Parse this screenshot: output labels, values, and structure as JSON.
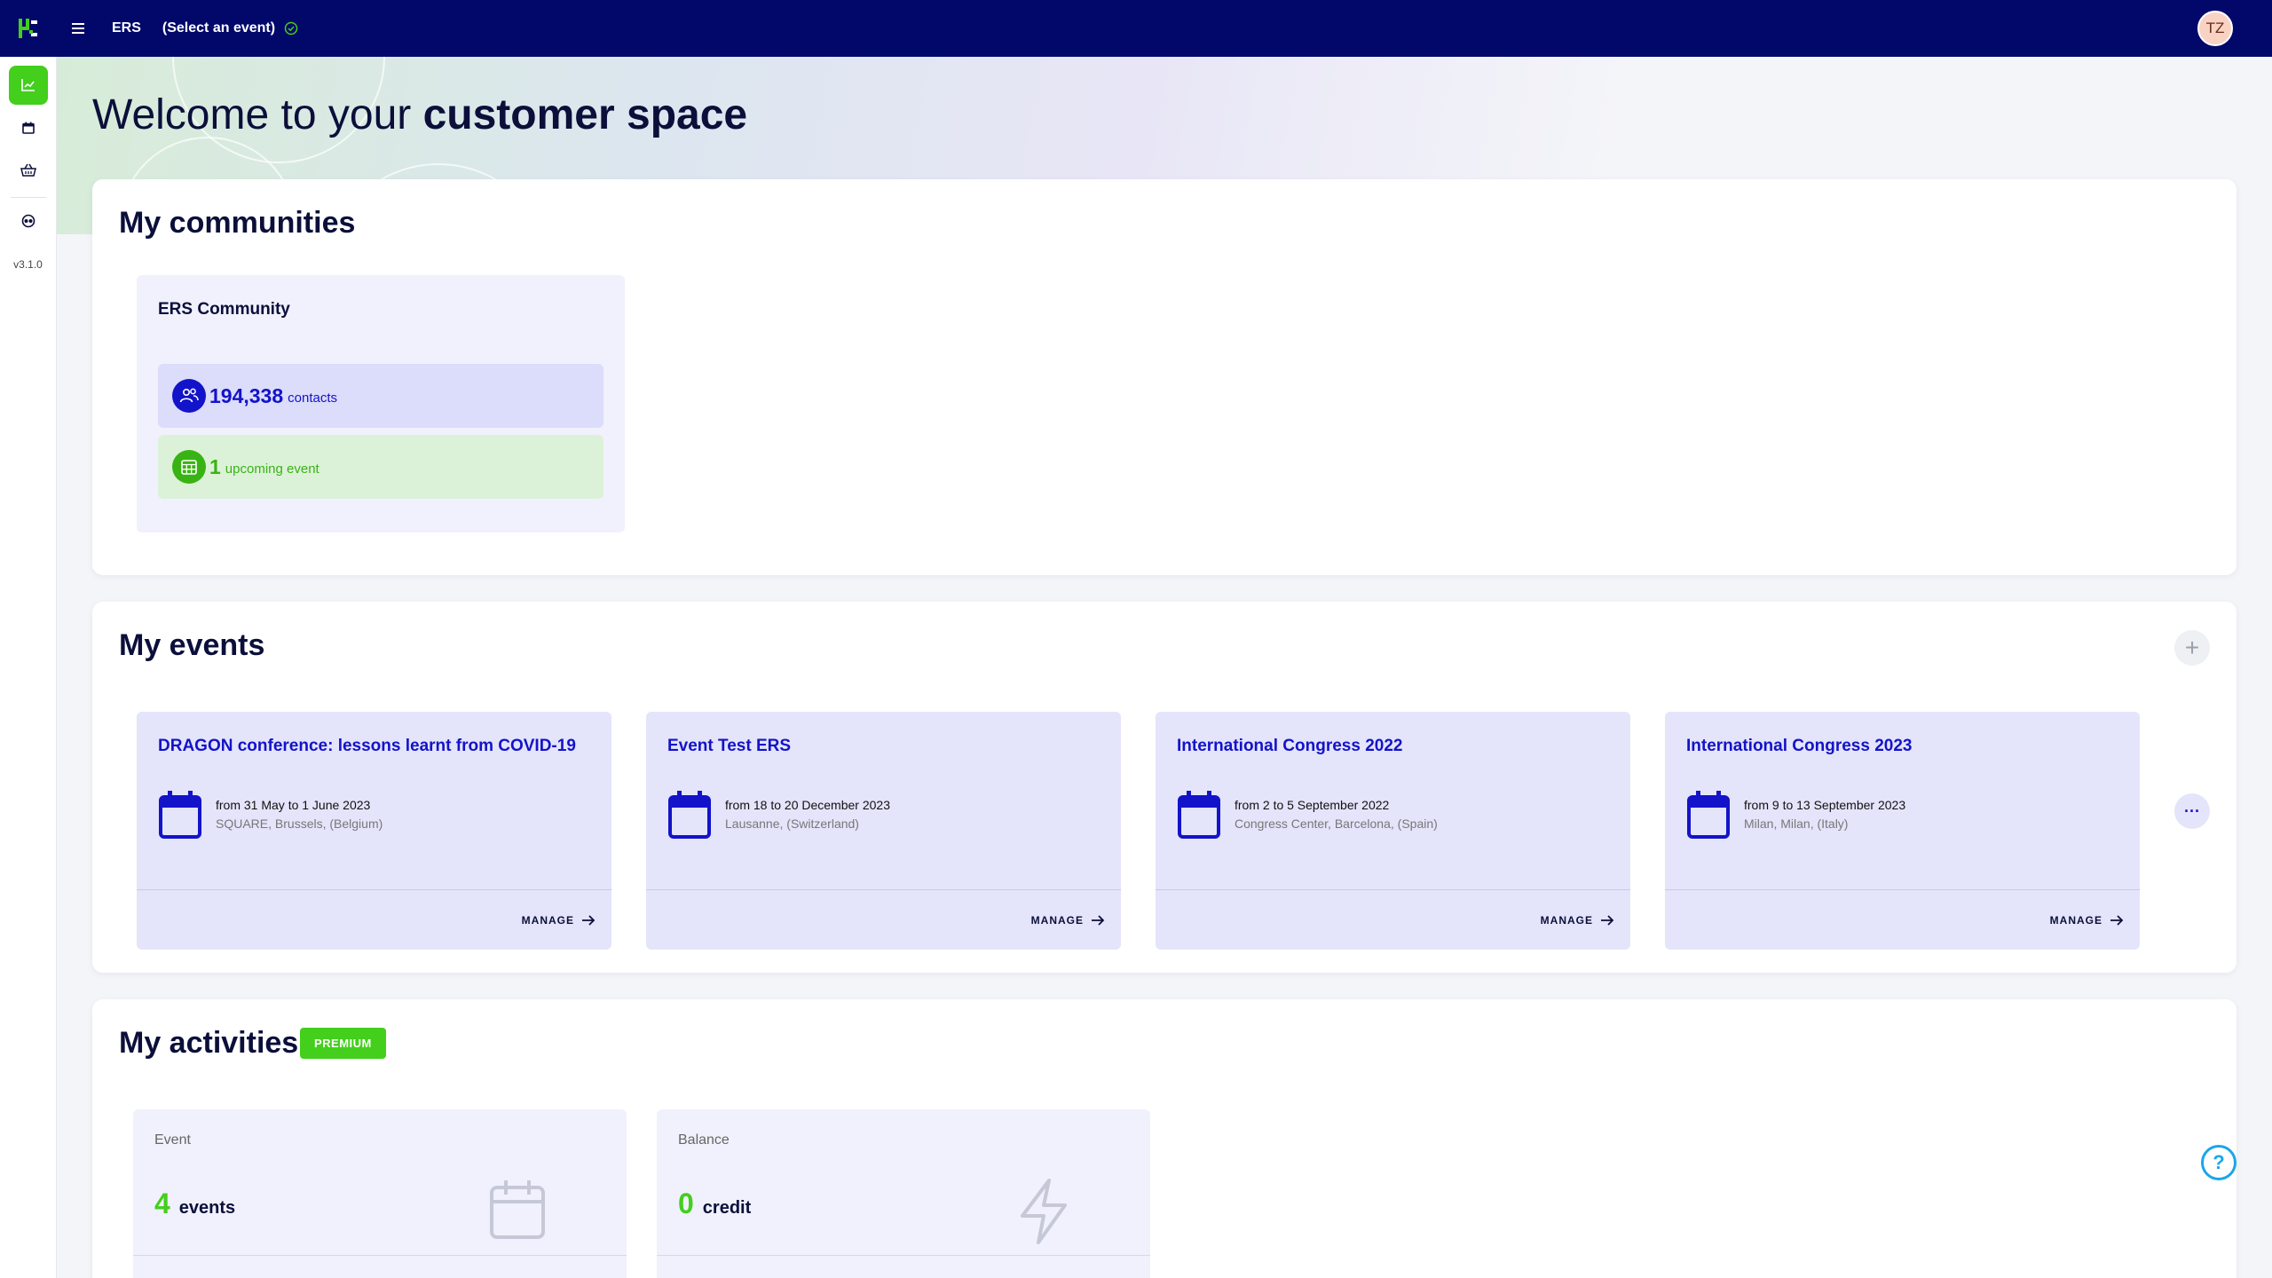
{
  "topbar": {
    "app_name": "ERS",
    "event_select": "(Select an event)",
    "avatar_initials": "TZ"
  },
  "sidebar": {
    "items": [
      {
        "icon": "chart-icon",
        "active": true
      },
      {
        "icon": "calendar-icon",
        "active": false
      },
      {
        "icon": "basket-icon",
        "active": false
      },
      {
        "icon": "support-icon",
        "active": false
      }
    ],
    "version": "v3.1.0"
  },
  "welcome": {
    "prefix": "Welcome to your ",
    "emphasis": "customer space"
  },
  "communities": {
    "title": "My communities",
    "items": [
      {
        "name": "ERS Community",
        "contacts_value": "194,338",
        "contacts_label": "contacts",
        "upcoming_value": "1",
        "upcoming_label": "upcoming event"
      }
    ]
  },
  "events": {
    "title": "My events",
    "add_label": "+",
    "more_label": "···",
    "manage_label": "MANAGE",
    "items": [
      {
        "title": "DRAGON conference: lessons learnt from COVID-19",
        "dates": "from 31 May to 1 June 2023",
        "location": "SQUARE, Brussels, (Belgium)"
      },
      {
        "title": "Event Test ERS",
        "dates": "from 18 to 20 December 2023",
        "location": "Lausanne, (Switzerland)"
      },
      {
        "title": "International Congress 2022",
        "dates": "from 2 to 5 September 2022",
        "location": "Congress Center, Barcelona, (Spain)"
      },
      {
        "title": "International Congress 2023",
        "dates": "from 9 to 13 September 2023",
        "location": "Milan, Milan, (Italy)"
      }
    ]
  },
  "activities": {
    "title": "My activities",
    "badge": "PREMIUM",
    "items": [
      {
        "label": "Event",
        "value": "4",
        "unit": "events",
        "icon": "calendar-icon"
      },
      {
        "label": "Balance",
        "value": "0",
        "unit": "credit",
        "icon": "lightning-icon"
      }
    ]
  },
  "help": {
    "label": "?"
  },
  "colors": {
    "navy": "#01086a",
    "accent_green": "#43cf1c",
    "accent_blue": "#1313c9"
  }
}
